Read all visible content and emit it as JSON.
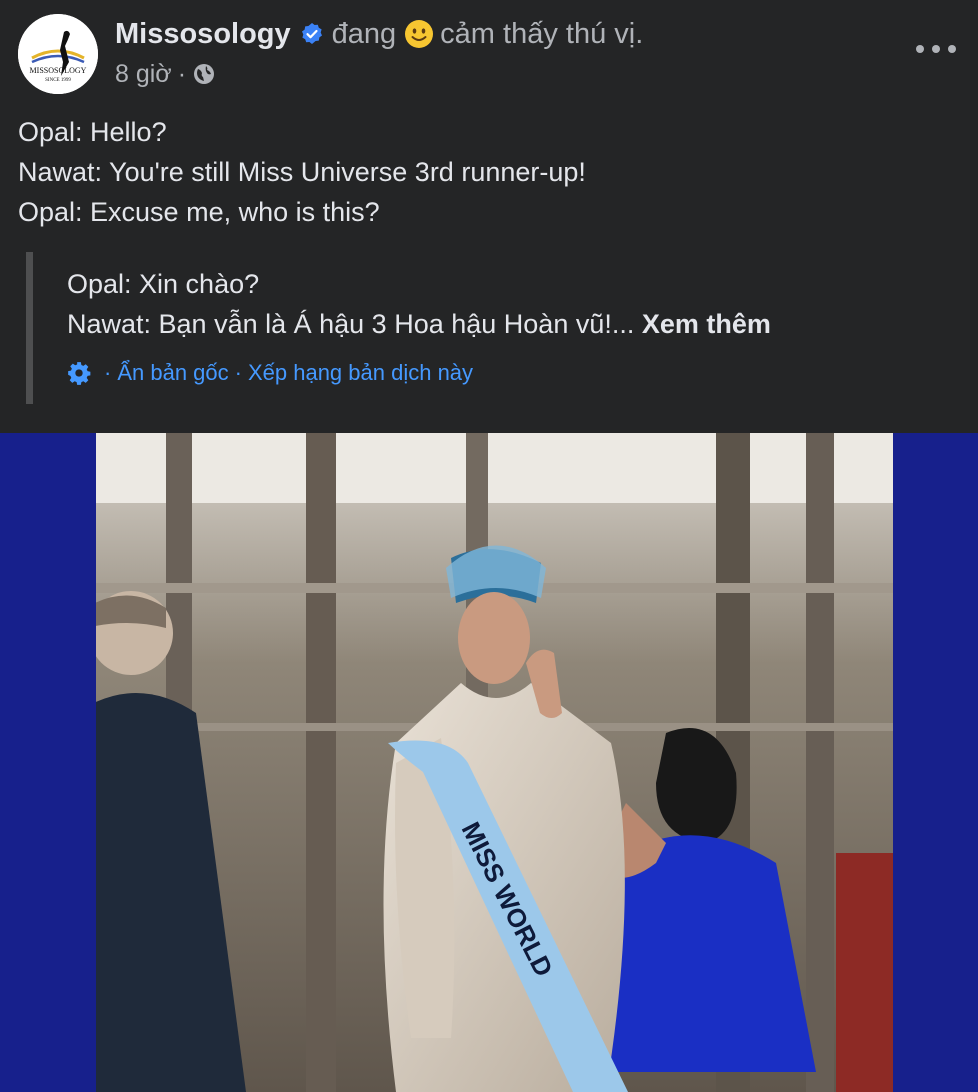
{
  "post": {
    "author": "Missosology",
    "verified": true,
    "activity_verb": "đang",
    "activity": "cảm thấy thú vị.",
    "time": "8 giờ",
    "audience_icon": "globe-icon",
    "avatar_logo": {
      "brand": "MISSOSOLOGY",
      "tagline": "SINCE 1999"
    }
  },
  "text_lines": [
    "Opal: Hello?",
    "Nawat: You're still Miss Universe 3rd runner-up!",
    "Opal: Excuse me, who is this?"
  ],
  "translation": {
    "lines": [
      "Opal: Xin chào?",
      "Nawat: Bạn vẫn là Á hậu 3 Hoa hậu Hoàn vũ!..."
    ],
    "see_more": "Xem thêm",
    "hide_original": "Ẩn bản gốc",
    "rate": "Xếp hạng bản dịch này"
  },
  "media": {
    "sash_text": "MISS WORLD",
    "colors": {
      "frame": "#17208c",
      "sash": "#9cc8ea",
      "dress": "#d8cdbf",
      "suit": "#1f2a3a",
      "blue_dress": "#1a2fc4"
    }
  },
  "colors": {
    "background": "#242526",
    "text": "#e4e6eb",
    "secondary": "#b0b3b8",
    "link": "#4599ff",
    "verified": "#3b82f6"
  }
}
